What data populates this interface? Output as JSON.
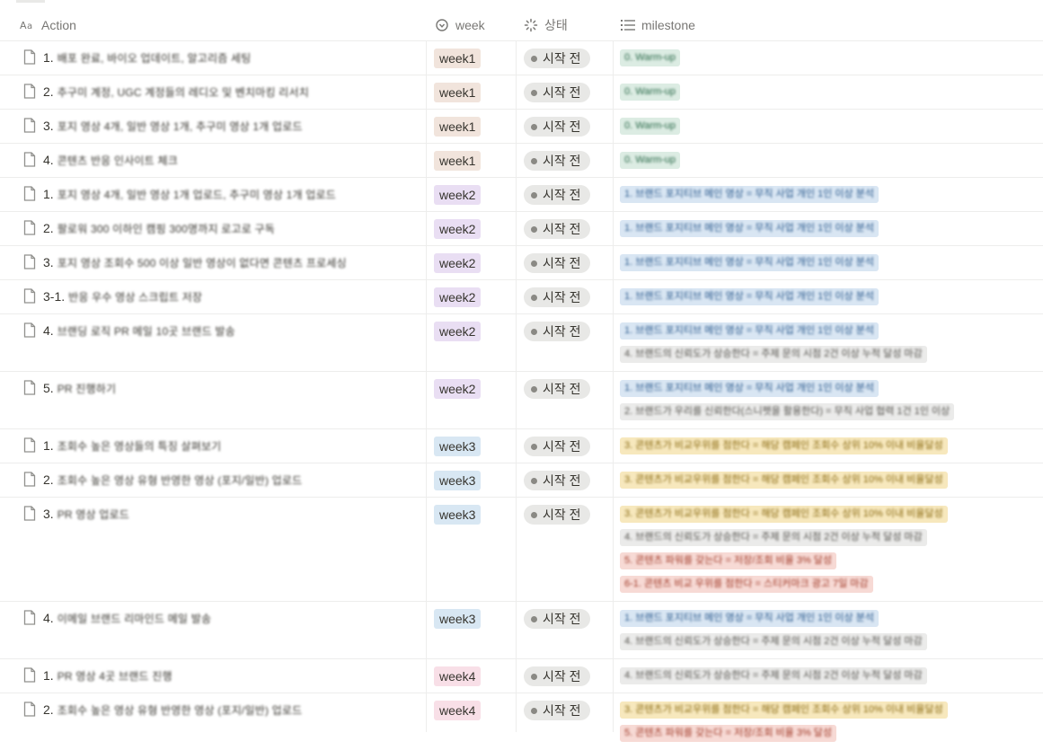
{
  "columns": {
    "action": "Action",
    "week": "week",
    "state": "상태",
    "milestone": "milestone"
  },
  "colors": {
    "week1": "#f1e4dc",
    "week2": "#e9def3",
    "week3": "#d8e7f3",
    "week4": "#f8dfe7",
    "status": "#e8e8e6",
    "milestone_green": "#dcece3",
    "milestone_blue": "#d9e6f3",
    "milestone_gray": "#ebebea",
    "milestone_yellow": "#f7e8bd",
    "milestone_red": "#f7dad5"
  },
  "rows": [
    {
      "num": "1.",
      "title": "배포 완료, 바이오 업데이트, 알고리즘 세팅",
      "week": "week1",
      "status": "시작 전",
      "milestones": [
        {
          "text": "0. Warm-up",
          "color": "green"
        }
      ]
    },
    {
      "num": "2.",
      "title": "추구미 계정, UGC 계정들의 레디오 및 벤치마킹 리서치",
      "week": "week1",
      "status": "시작 전",
      "milestones": [
        {
          "text": "0. Warm-up",
          "color": "green"
        }
      ]
    },
    {
      "num": "3.",
      "title": "포지 영상 4개, 일반 영상 1개, 추구미 영상 1개 업로드",
      "week": "week1",
      "status": "시작 전",
      "milestones": [
        {
          "text": "0. Warm-up",
          "color": "green"
        }
      ]
    },
    {
      "num": "4.",
      "title": "콘텐츠 반응 인사이트 체크",
      "week": "week1",
      "status": "시작 전",
      "milestones": [
        {
          "text": "0. Warm-up",
          "color": "green"
        }
      ]
    },
    {
      "num": "1.",
      "title": "포지 영상 4개, 일반 영상 1개 업로드, 추구미 영상 1개 업로드",
      "week": "week2",
      "status": "시작 전",
      "milestones": [
        {
          "text": "1. 브랜드 포지티브 메인 영상 = 무직 사업 개인 1인 이상 분석",
          "color": "blue"
        }
      ]
    },
    {
      "num": "2.",
      "title": "팔로워 300 이하인 캠핑 300명까지 로고로 구독",
      "week": "week2",
      "status": "시작 전",
      "milestones": [
        {
          "text": "1. 브랜드 포지티브 메인 영상 = 무직 사업 개인 1인 이상 분석",
          "color": "blue"
        }
      ]
    },
    {
      "num": "3.",
      "title": "포지 영상 조회수 500 이상 일반 영상이 없다면 콘텐츠 프로세싱",
      "week": "week2",
      "status": "시작 전",
      "milestones": [
        {
          "text": "1. 브랜드 포지티브 메인 영상 = 무직 사업 개인 1인 이상 분석",
          "color": "blue"
        }
      ]
    },
    {
      "num": "3-1.",
      "title": "반응 우수 영상 스크립트 저장",
      "week": "week2",
      "status": "시작 전",
      "milestones": [
        {
          "text": "1. 브랜드 포지티브 메인 영상 = 무직 사업 개인 1인 이상 분석",
          "color": "blue"
        }
      ]
    },
    {
      "num": "4.",
      "title": "브랜딩 로직 PR 메일 10곳 브랜드 발송",
      "week": "week2",
      "status": "시작 전",
      "milestones": [
        {
          "text": "1. 브랜드 포지티브 메인 영상 = 무직 사업 개인 1인 이상 분석",
          "color": "blue"
        },
        {
          "text": "4. 브랜드의 신뢰도가 상승한다 = 주제 문의 시점 2건 이상 누적 달성 마감",
          "color": "gray"
        }
      ]
    },
    {
      "num": "5.",
      "title": "PR 진행하기",
      "week": "week2",
      "status": "시작 전",
      "milestones": [
        {
          "text": "1. 브랜드 포지티브 메인 영상 = 무직 사업 개인 1인 이상 분석",
          "color": "blue"
        },
        {
          "text": "2. 브랜드가 우리를 신뢰한다(스니펫을 활용한다) = 무직 사업 협력 1건 1인 이상",
          "color": "gray"
        }
      ]
    },
    {
      "num": "1.",
      "title": "조회수 높은 영상들의 특징 살펴보기",
      "week": "week3",
      "status": "시작 전",
      "milestones": [
        {
          "text": "3. 콘텐츠가 비교우위를 점한다 = 해당 캠페인 조회수 상위 10% 이내 비율달성",
          "color": "yellow"
        }
      ]
    },
    {
      "num": "2.",
      "title": "조회수 높은 영상 유형 반영한 영상 (포지/일반) 업로드",
      "week": "week3",
      "status": "시작 전",
      "milestones": [
        {
          "text": "3. 콘텐츠가 비교우위를 점한다 = 해당 캠페인 조회수 상위 10% 이내 비율달성",
          "color": "yellow"
        }
      ]
    },
    {
      "num": "3.",
      "title": "PR 영상 업로드",
      "week": "week3",
      "status": "시작 전",
      "milestones": [
        {
          "text": "3. 콘텐츠가 비교우위를 점한다 = 해당 캠페인 조회수 상위 10% 이내 비율달성",
          "color": "yellow"
        },
        {
          "text": "4. 브랜드의 신뢰도가 상승한다 = 주제 문의 시점 2건 이상 누적 달성 마감",
          "color": "gray"
        },
        {
          "text": "5. 콘텐츠 파워를 갖는다 = 저장/조회 비율 3% 달성",
          "color": "red"
        },
        {
          "text": "6-1. 콘텐츠 비교 우위를 점한다 = 스티커마크 광고 7일 마감",
          "color": "red"
        }
      ]
    },
    {
      "num": "4.",
      "title": "이메일 브랜드 리마인드 메일 발송",
      "week": "week3",
      "status": "시작 전",
      "milestones": [
        {
          "text": "1. 브랜드 포지티브 메인 영상 = 무직 사업 개인 1인 이상 분석",
          "color": "blue"
        },
        {
          "text": "4. 브랜드의 신뢰도가 상승한다 = 주제 문의 시점 2건 이상 누적 달성 마감",
          "color": "gray"
        }
      ]
    },
    {
      "num": "1.",
      "title": "PR 영상 4곳 브랜드 진행",
      "week": "week4",
      "status": "시작 전",
      "milestones": [
        {
          "text": "4. 브랜드의 신뢰도가 상승한다 = 주제 문의 시점 2건 이상 누적 달성 마감",
          "color": "gray"
        }
      ]
    },
    {
      "num": "2.",
      "title": "조회수 높은 영상 유형 반영한 영상 (포지/일반) 업로드",
      "week": "week4",
      "status": "시작 전",
      "milestones": [
        {
          "text": "3. 콘텐츠가 비교우위를 점한다 = 해당 캠페인 조회수 상위 10% 이내 비율달성",
          "color": "yellow"
        },
        {
          "text": "5. 콘텐츠 파워를 갖는다 = 저장/조회 비율 3% 달성",
          "color": "red"
        }
      ]
    }
  ]
}
